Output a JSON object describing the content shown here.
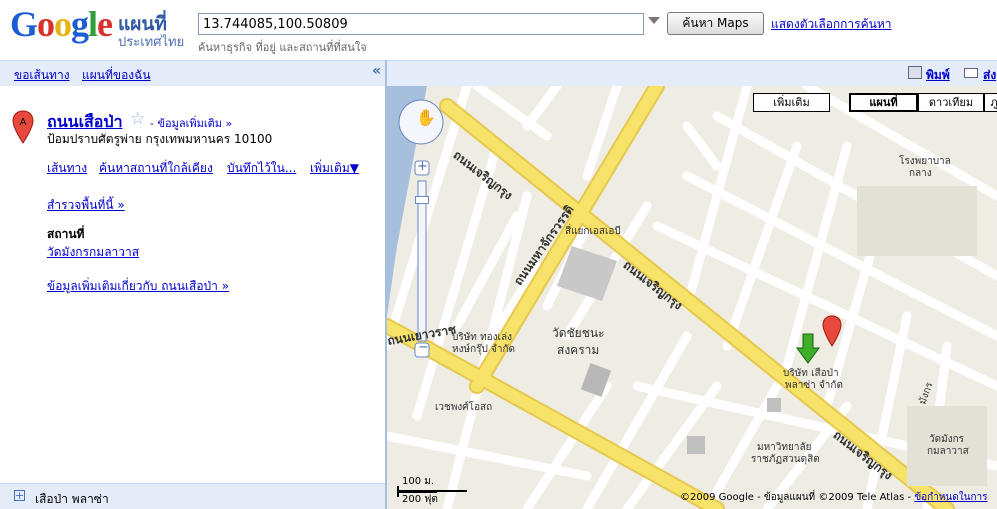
{
  "header": {
    "logo_text": "Google",
    "logo_sub1": "แผนที่",
    "logo_sub2": "ประเทศไทย",
    "search_value": "13.744085,100.50809",
    "search_button": "ค้นหา Maps",
    "search_options": "แสดงตัวเลือกการค้นหา",
    "search_hint": "ค้นหาธุรกิจ ที่อยู่ และสถานที่ที่สนใจ"
  },
  "left_bar": {
    "directions": "ขอเส้นทาง",
    "my_maps": "แผนที่ของฉัน",
    "collapse": "«"
  },
  "place": {
    "marker": "A",
    "title": "ถนนเสือป่า",
    "more_info": "- ข้อมูลเพิ่มเติม »",
    "address": "ป้อมปราบศัตรูพ่าย กรุงเทพมหานคร 10100",
    "actions": [
      "เส้นทาง",
      "ค้นหาสถานที่ใกล้เคียง",
      "บันทึกไว้ใน...",
      "เพิ่มเติม▼"
    ],
    "explore": "สำรวจพื้นที่นี้ »",
    "places_heading": "สถานที่",
    "place_link": "วัดมังกรกมลาวาส",
    "more_about": "ข้อมูลเพิ่มเติมเกี่ยวกับ ถนนเสือป่า »"
  },
  "left_footer": {
    "label": "เสือป่า พลาซ่า"
  },
  "map_bar": {
    "print": "พิมพ์",
    "send": "ส่ง"
  },
  "map": {
    "types": [
      "เพิ่มเติม",
      "แผนที่",
      "ดาวเทียม",
      "ภู"
    ],
    "active_type": "แผนที่",
    "scale_metric": "100 ม.",
    "scale_imperial": "200 ฟุต",
    "copyright_prefix": "©2009 Google - ข้อมูลแผนที่ ©2009 Tele Atlas -",
    "terms": "ข้อกำหนดในการ",
    "labels": {
      "road_main1": "ถนนเจริญกรุง",
      "road_main2": "ถนนเจริญกรุง",
      "road_main3": "ถนนเจริญกรุง",
      "road_mahachak": "ถนนมหาจักรวรรดิ",
      "road_yaowarat": "ถนนเยาวราช",
      "temple": "วัดชัยชนะ",
      "temple2": "สงคราม",
      "intersection": "สี่แยกเอสเอบี",
      "company1": "บริษัท ทองเล่ง",
      "company1b": "หงษ์กรุ๊ป จำกัด",
      "company2": "บริษัท เสือป่า",
      "company2b": "พลาซ่า จำกัด",
      "hospital": "โรงพยาบาล",
      "hospital2": "กลาง",
      "wat_mangkon": "วัดมังกร",
      "wat_mangkon2": "กมลาวาส",
      "univ": "มหาวิทยาลัย",
      "univ2": "ราชภัฏสวนดุสิต",
      "pharmacy": "เวชพงศ์โอสถ",
      "mangkon": "มังกร"
    }
  }
}
